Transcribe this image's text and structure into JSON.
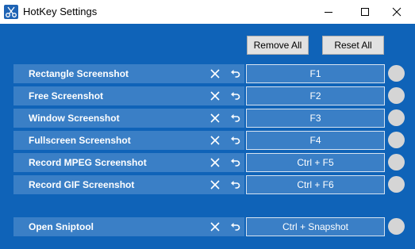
{
  "window": {
    "title": "HotKey Settings",
    "app_icon": "scissors-icon",
    "controls": [
      "minimize-icon",
      "maximize-icon",
      "close-icon"
    ],
    "colors": {
      "background": "#0f63b8",
      "row": "#3a7fc6",
      "status_dot": "#d5d5d5",
      "titlebar": "#ffffff"
    }
  },
  "toolbar": {
    "remove_all_label": "Remove All",
    "reset_all_label": "Reset All"
  },
  "hotkeys": [
    {
      "name": "Rectangle Screenshot",
      "key": "F1"
    },
    {
      "name": "Free Screenshot",
      "key": "F2"
    },
    {
      "name": "Window Screenshot",
      "key": "F3"
    },
    {
      "name": "Fullscreen Screenshot",
      "key": "F4"
    },
    {
      "name": "Record MPEG Screenshot",
      "key": "Ctrl + F5"
    },
    {
      "name": "Record GIF Screenshot",
      "key": "Ctrl + F6"
    },
    {
      "name": "Open Sniptool",
      "key": "Ctrl + Snapshot"
    }
  ],
  "row_icons": {
    "clear": "clear-x-icon",
    "undo": "undo-arrow-icon"
  }
}
